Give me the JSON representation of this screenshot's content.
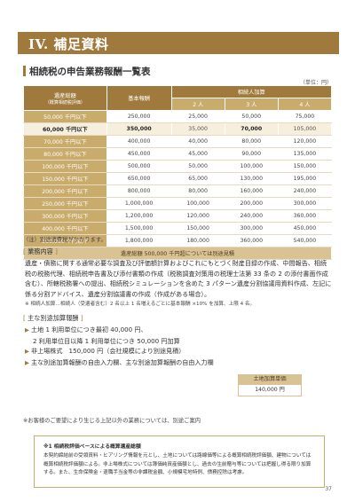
{
  "banner": {
    "title": "IV. 補足資料"
  },
  "section": {
    "title": "相続税の申告業務報酬一覧表"
  },
  "unit_note": "（単位：円）",
  "table": {
    "headers": {
      "estate": "遺産総額",
      "estate_sub": "（概算相続税評価）",
      "base": "基本報酬",
      "heirs": "相続人加算",
      "heir_cols": [
        "2 人",
        "3 人",
        "4 人"
      ]
    },
    "rows": [
      {
        "band": "50,000 千円以下",
        "base": "250,000",
        "h2": "25,000",
        "h3": "50,000",
        "h4": "75,000"
      },
      {
        "band": "60,000 千円以下",
        "base": "350,000",
        "h2": "35,000",
        "h3": "70,000",
        "h4": "105,000"
      },
      {
        "band": "70,000 千円以下",
        "base": "400,000",
        "h2": "40,000",
        "h3": "80,000",
        "h4": "120,000"
      },
      {
        "band": "80,000 千円以下",
        "base": "450,000",
        "h2": "45,000",
        "h3": "90,000",
        "h4": "135,000"
      },
      {
        "band": "100,000 千円以下",
        "base": "500,000",
        "h2": "50,000",
        "h3": "100,000",
        "h4": "150,000"
      },
      {
        "band": "150,000 千円以下",
        "base": "650,000",
        "h2": "65,000",
        "h3": "130,000",
        "h4": "195,000"
      },
      {
        "band": "200,000 千円以下",
        "base": "800,000",
        "h2": "80,000",
        "h3": "160,000",
        "h4": "240,000"
      },
      {
        "band": "250,000 千円以下",
        "base": "1,000,000",
        "h2": "100,000",
        "h3": "200,000",
        "h4": "300,000"
      },
      {
        "band": "300,000 千円以下",
        "base": "1,200,000",
        "h2": "120,000",
        "h3": "240,000",
        "h4": "360,000"
      },
      {
        "band": "400,000 千円以下",
        "base": "1,500,000",
        "h2": "150,000",
        "h3": "300,000",
        "h4": "450,000"
      },
      {
        "band": "500,000 千円以下",
        "base": "1,800,000",
        "h2": "180,000",
        "h3": "360,000",
        "h4": "540,000"
      }
    ],
    "footer": "遺産総額 500,000 千円超については別途見積"
  },
  "tax_note": "（注）別途消費税がかかります。",
  "scope": {
    "label": "業務内容",
    "text": "遺産・債務に関する通常必要な調査及び評価額計算およびこれにもとづく財産目録の作成、中間報告、相続税の税務代理、相続税申告書及び添付書類の作成（税務調査対策用の税理士法第 33 条の 2 の添付書面作成含む）、所轄税務署への提出、相続税シミュレーションを含めた 3 パターン遺産分割協議用資料作成、左記に係る分割アドバイス、遺産分割協議書の作成（作成がある場合）。",
    "note": "※ 相続人加算…相続人（受遺者含む）2 名以上 1 名増えるごとに基本報酬 ×10% を加算、上限 4 名。"
  },
  "additional": {
    "label": "主な別途加算報酬",
    "items": [
      {
        "line1": "土地 1 利用単位につき最初 40,000 円、",
        "line2": "2 利用単位目以降 1 利用単位につき 50,000 円加算"
      },
      {
        "line1": "非上場株式　150,000 円（会社規模により別途見積）"
      },
      {
        "line1": "主な別途加算報酬の自由入力欄、主な別途加算報酬の自由入力欄"
      }
    ],
    "land_box": {
      "label": "土地加算単価",
      "value": "140,000 円"
    },
    "closing": "※お客様のご要望により生じる上記以外の業務については、別途ご案内"
  },
  "footnote": {
    "title": "※1 相続税評価ベースによる概算遺産総額",
    "text": "本契約締結前の受領資料・ヒアリング情報を元とし、土地については路線価等による概算相続税評価額、建物については概算相続税評価額による。非上場株式については簿価純資産価額とし、過去の生前贈与等については把握し得る限り加算する。また、生命保険金・退職手当金等の非課税金額、小規模宅地特例、債務控除は考慮。"
  },
  "page_number": "37",
  "colors": {
    "accent": "#a07a3c",
    "accent_light": "#c9ab6c",
    "highlight_row": "#f6efdd",
    "footer_cell": "#d9c394"
  }
}
